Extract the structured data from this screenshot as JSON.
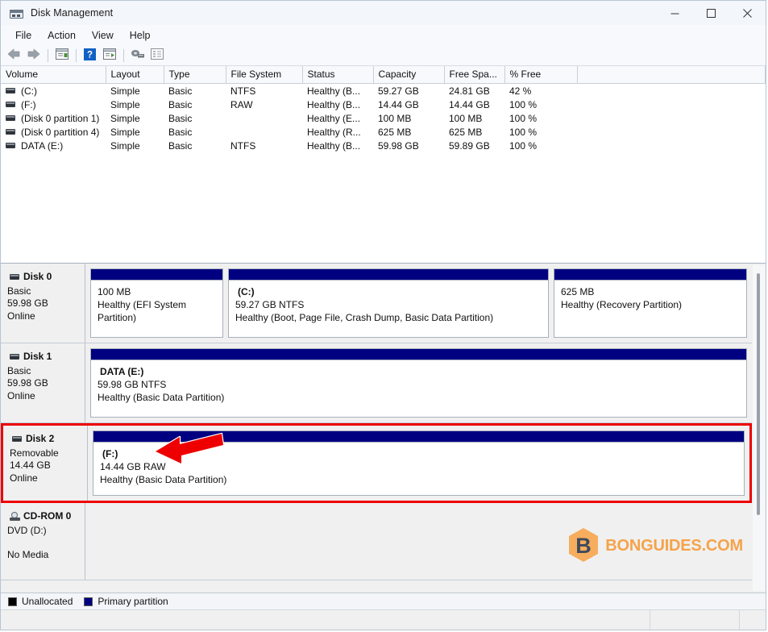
{
  "window": {
    "title": "Disk Management",
    "icon": "disk-management-icon",
    "controls": {
      "minimize": "minimize-button",
      "maximize": "maximize-button",
      "close": "close-button"
    }
  },
  "menubar": {
    "items": [
      {
        "label": "File",
        "name": "menu-file"
      },
      {
        "label": "Action",
        "name": "menu-action"
      },
      {
        "label": "View",
        "name": "menu-view"
      },
      {
        "label": "Help",
        "name": "menu-help"
      }
    ]
  },
  "toolbar": {
    "buttons": [
      {
        "name": "back-button",
        "icon": "back-arrow-icon"
      },
      {
        "name": "forward-button",
        "icon": "forward-arrow-icon"
      },
      {
        "name": "up-one-level-button",
        "icon": "list-panel-icon"
      },
      {
        "name": "help-button",
        "icon": "question-mark-icon"
      },
      {
        "name": "show-hide-console-tree-button",
        "icon": "list-panel-play-icon"
      },
      {
        "name": "rescan-disks-button",
        "icon": "disk-scan-icon"
      },
      {
        "name": "properties-button",
        "icon": "properties-list-icon"
      }
    ]
  },
  "volume_table": {
    "columns": [
      "Volume",
      "Layout",
      "Type",
      "File System",
      "Status",
      "Capacity",
      "Free Spa...",
      "% Free"
    ],
    "rows": [
      {
        "volume": "(C:)",
        "layout": "Simple",
        "type": "Basic",
        "file_system": "NTFS",
        "status": "Healthy (B...",
        "capacity": "59.27 GB",
        "free_space": "24.81 GB",
        "percent_free": "42 %"
      },
      {
        "volume": "(F:)",
        "layout": "Simple",
        "type": "Basic",
        "file_system": "RAW",
        "status": "Healthy (B...",
        "capacity": "14.44 GB",
        "free_space": "14.44 GB",
        "percent_free": "100 %"
      },
      {
        "volume": "(Disk 0 partition 1)",
        "layout": "Simple",
        "type": "Basic",
        "file_system": "",
        "status": "Healthy (E...",
        "capacity": "100 MB",
        "free_space": "100 MB",
        "percent_free": "100 %"
      },
      {
        "volume": "(Disk 0 partition 4)",
        "layout": "Simple",
        "type": "Basic",
        "file_system": "",
        "status": "Healthy (R...",
        "capacity": "625 MB",
        "free_space": "625 MB",
        "percent_free": "100 %"
      },
      {
        "volume": "DATA (E:)",
        "layout": "Simple",
        "type": "Basic",
        "file_system": "NTFS",
        "status": "Healthy (B...",
        "capacity": "59.98 GB",
        "free_space": "59.89 GB",
        "percent_free": "100 %"
      }
    ]
  },
  "disks": [
    {
      "name": "Disk 0",
      "type": "Basic",
      "size": "59.98 GB",
      "state": "Online",
      "highlighted": false,
      "partitions": [
        {
          "label": "",
          "size_fs": "100 MB",
          "status": "Healthy (EFI System Partition)"
        },
        {
          "label": "(C:)",
          "size_fs": "59.27 GB NTFS",
          "status": "Healthy (Boot, Page File, Crash Dump, Basic Data Partition)"
        },
        {
          "label": "",
          "size_fs": "625 MB",
          "status": "Healthy (Recovery Partition)"
        }
      ]
    },
    {
      "name": "Disk 1",
      "type": "Basic",
      "size": "59.98 GB",
      "state": "Online",
      "highlighted": false,
      "partitions": [
        {
          "label": "DATA  (E:)",
          "size_fs": "59.98 GB NTFS",
          "status": "Healthy (Basic Data Partition)"
        }
      ]
    },
    {
      "name": "Disk 2",
      "type": "Removable",
      "size": "14.44 GB",
      "state": "Online",
      "highlighted": true,
      "partitions": [
        {
          "label": "(F:)",
          "size_fs": "14.44 GB RAW",
          "status": "Healthy (Basic Data Partition)"
        }
      ]
    },
    {
      "name": "CD-ROM 0",
      "type": "DVD (D:)",
      "size": "",
      "state": "No Media",
      "highlighted": false,
      "partitions": []
    }
  ],
  "legend": {
    "items": [
      {
        "label": "Unallocated",
        "color": "#000000"
      },
      {
        "label": "Primary partition",
        "color": "#000080"
      }
    ]
  },
  "annotations": {
    "highlight_color": "#ee0000",
    "arrow_color": "#ee0000",
    "watermark_text": "BONGUIDES.COM",
    "watermark_letter": "B",
    "watermark_color": "#f5a34a"
  }
}
